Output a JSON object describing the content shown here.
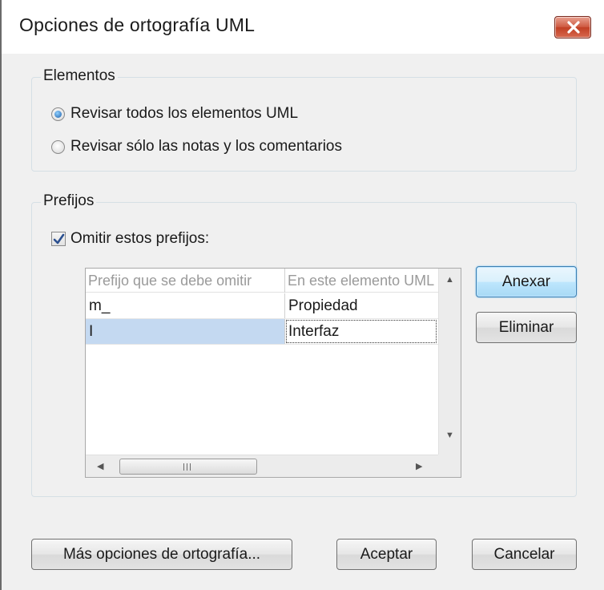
{
  "window": {
    "title": "Opciones de ortografía UML"
  },
  "elements_group": {
    "title": "Elementos",
    "options": [
      {
        "label": "Revisar todos los elementos UML",
        "checked": true
      },
      {
        "label": "Revisar sólo las notas y los comentarios",
        "checked": false
      }
    ]
  },
  "prefixes_group": {
    "title": "Prefijos",
    "omit_checkbox": {
      "label": "Omitir estos prefijos:",
      "checked": true
    },
    "table": {
      "columns": [
        "Prefijo que se debe omitir",
        "En este elemento UML"
      ],
      "rows": [
        {
          "prefix": "m_",
          "element": "Propiedad",
          "selected": false
        },
        {
          "prefix": "I",
          "element": "Interfaz",
          "selected": true
        }
      ]
    },
    "buttons": {
      "add": "Anexar",
      "remove": "Eliminar"
    }
  },
  "footer": {
    "more_options": "Más opciones de ortografía...",
    "ok": "Aceptar",
    "cancel": "Cancelar"
  },
  "colors": {
    "selection": "#c4d9f1",
    "default_button_border": "#3c7fb1",
    "close_button": "#c94a30"
  }
}
